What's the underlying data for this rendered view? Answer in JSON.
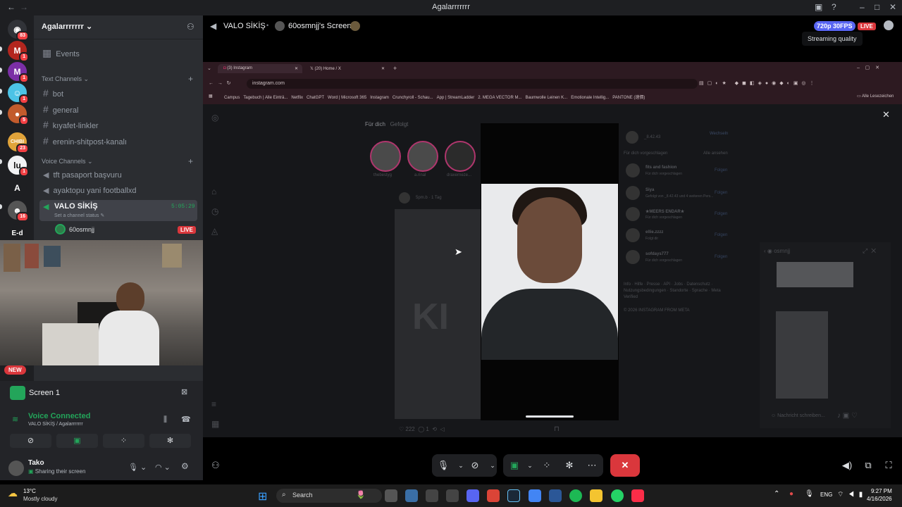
{
  "window": {
    "title": "Agalarrrrrrr"
  },
  "header": {
    "channel": "VALO SİKİŞ",
    "screen": "60osmnjj's Screen",
    "quality": "720p 30FPS",
    "live": "LIVE",
    "tooltip": "Streaming quality"
  },
  "servers": [
    {
      "badge": "83"
    },
    {
      "badge": "1"
    },
    {
      "badge": "1"
    },
    {
      "badge": "1"
    },
    {
      "badge": "5"
    },
    {
      "badge": "23",
      "label": "CHIBI"
    },
    {
      "badge": "1"
    },
    {
      "badge": "",
      "label": "A"
    },
    {
      "badge": "16"
    },
    {
      "badge": "",
      "label": "E-d"
    }
  ],
  "guild": {
    "name": "Agalarrrrrrr",
    "events": "Events"
  },
  "text_category": "Text Channels",
  "text_channels": [
    "bot",
    "general",
    "kıyafet-linkler",
    "erenin-shitpost-kanalı"
  ],
  "voice_category": "Voice Channels",
  "voice_channels": [
    "tft pasaport başvuru",
    "ayaktopu yani footballxd"
  ],
  "active_voice": {
    "name": "VALO SİKİŞ",
    "timer": "5:05:29",
    "status": "Set a channel status",
    "member": "60osmnjj",
    "member_badge": "LIVE"
  },
  "panel": {
    "new": "NEW",
    "screen_title": "Screen 1",
    "voice_connected": "Voice Connected",
    "voice_location": "VALO SİKİŞ / Agalarrrrrrr",
    "user": "Tako",
    "user_status": "Sharing their screen"
  },
  "browser": {
    "tabs": [
      "(3) Instagram",
      "(20) Home / X"
    ],
    "url": "instagram.com",
    "bookmarks": [
      "Campus",
      "Tagebuch | Alle Einträ...",
      "Netflix",
      "ChatGPT",
      "Word | Microsoft 365",
      "Instagram",
      "Crunchyroll - Schau...",
      "App | StreamLadder",
      "2. MEGA VECTOR M...",
      "Baumwolle Leinen K...",
      "Emotionale Intellig...",
      "PANTONE (速價)"
    ],
    "bookmarks_right": "Alle Lesezeichen"
  },
  "instagram": {
    "feed_tabs": [
      "Für dich",
      "Gefolgt"
    ],
    "stories": [
      "thebestyg",
      "a.rinal",
      "draxerneze..."
    ],
    "post_user": "5pm.b",
    "post_time": "1 Tag",
    "post_likes": "222",
    "post_comments": "1",
    "profile": "_8.42.43",
    "profile_switch": "Wechseln",
    "suggest_title": "Für dich vorgeschlagen",
    "suggest_all": "Alle ansehen",
    "suggestions": [
      {
        "name": "fits and fashion",
        "sub": "Für dich vorgeschlagen",
        "action": "Folgen"
      },
      {
        "name": "Siya",
        "sub": "Gefolgt von _8.42.43 und 4 weiteren Pers...",
        "action": "Folgen"
      },
      {
        "name": "★MEERS ENDAR★",
        "sub": "Für dich vorgeschlagen",
        "action": "Folgen"
      },
      {
        "name": "ellie.zzzz",
        "sub": "Folgt dir",
        "action": "Folgen"
      },
      {
        "name": "sofdays777",
        "sub": "Für dich vorgeschlagen",
        "action": "Folgen"
      }
    ],
    "footer": "Info · Hilfe · Presse · API · Jobs · Datenschutz · Nutzungsbedingungen · Standorte · Sprache · Meta Verified",
    "copyright": "© 2026 INSTAGRAM FROM META",
    "dm_user": "osmnjj",
    "dm_placeholder": "Nachricht schreiben..."
  },
  "taskbar": {
    "temp": "13°C",
    "weather": "Mostly cloudy",
    "search": "Search",
    "lang": "ENG",
    "time": "9:27 PM",
    "date": "4/16/2026"
  },
  "colors": {
    "blurple": "#5865f2",
    "red": "#da373c",
    "green": "#23a55a"
  }
}
